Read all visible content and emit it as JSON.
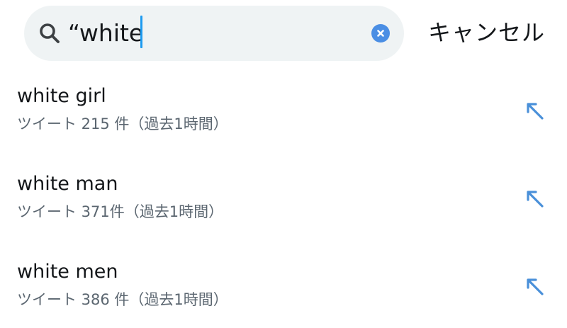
{
  "search": {
    "query": "“white",
    "clear_icon": "clear-icon",
    "search_icon": "search-icon",
    "cancel_label": "キャンセル"
  },
  "suggestions": [
    {
      "title": "white girl",
      "meta": "ツイート 215 件（過去1時間）",
      "icon": "fill-arrow-icon"
    },
    {
      "title": "white man",
      "meta": "ツイート 371件（過去1時間）",
      "icon": "fill-arrow-icon"
    },
    {
      "title": "white men",
      "meta": "ツイート 386 件（過去1時間）",
      "icon": "fill-arrow-icon"
    }
  ],
  "colors": {
    "accent": "#1d9bf0",
    "clear_button": "#4a8ee4",
    "search_bg": "#eff3f4",
    "secondary_text": "#5b6670",
    "arrow": "#4a90d9"
  }
}
